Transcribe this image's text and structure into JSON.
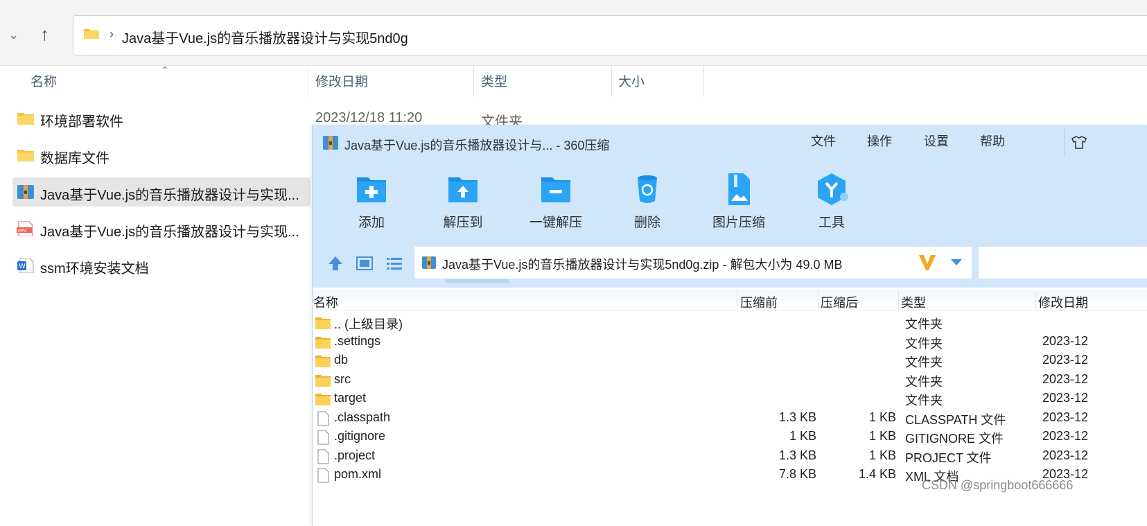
{
  "explorer": {
    "address_path": "Java基于Vue.js的音乐播放器设计与实现5nd0g",
    "columns": {
      "name": "名称",
      "modified": "修改日期",
      "type": "类型",
      "size": "大小"
    },
    "rows": [
      {
        "name": "环境部署软件",
        "date": "2023/12/18 11:20",
        "type": "文件夹",
        "icon": "folder-icon"
      },
      {
        "name": "数据库文件",
        "icon": "folder-icon"
      },
      {
        "name": "Java基于Vue.js的音乐播放器设计与实现...",
        "icon": "zip-archive-icon",
        "selected": true
      },
      {
        "name": "Java基于Vue.js的音乐播放器设计与实现...",
        "icon": "mp4-file-icon"
      },
      {
        "name": "ssm环境安装文档",
        "icon": "word-doc-icon"
      }
    ]
  },
  "zip_app": {
    "title": "Java基于Vue.js的音乐播放器设计与... - 360压缩",
    "menu": [
      "文件",
      "操作",
      "设置",
      "帮助"
    ],
    "toolbar": [
      {
        "label": "添加",
        "icon": "add-icon"
      },
      {
        "label": "解压到",
        "icon": "extract-to-icon"
      },
      {
        "label": "一键解压",
        "icon": "one-click-extract-icon"
      },
      {
        "label": "删除",
        "icon": "delete-icon"
      },
      {
        "label": "图片压缩",
        "icon": "image-compress-icon"
      },
      {
        "label": "工具",
        "icon": "tools-icon"
      }
    ],
    "path": "Java基于Vue.js的音乐播放器设计与实现5nd0g.zip - 解包大小为 49.0 MB",
    "columns": {
      "name": "名称",
      "before": "压缩前",
      "after": "压缩后",
      "type": "类型",
      "modified": "修改日期"
    },
    "files": [
      {
        "name": ".. (上级目录)",
        "before": "",
        "after": "",
        "type": "文件夹",
        "date": "",
        "icon": "folder-icon"
      },
      {
        "name": ".settings",
        "before": "",
        "after": "",
        "type": "文件夹",
        "date": "2023-12",
        "icon": "folder-icon"
      },
      {
        "name": "db",
        "before": "",
        "after": "",
        "type": "文件夹",
        "date": "2023-12",
        "icon": "folder-icon"
      },
      {
        "name": "src",
        "before": "",
        "after": "",
        "type": "文件夹",
        "date": "2023-12",
        "icon": "folder-icon"
      },
      {
        "name": "target",
        "before": "",
        "after": "",
        "type": "文件夹",
        "date": "2023-12",
        "icon": "folder-icon"
      },
      {
        "name": ".classpath",
        "before": "1.3 KB",
        "after": "1 KB",
        "type": "CLASSPATH 文件",
        "date": "2023-12",
        "icon": "file-icon"
      },
      {
        "name": ".gitignore",
        "before": "1 KB",
        "after": "1 KB",
        "type": "GITIGNORE 文件",
        "date": "2023-12",
        "icon": "file-icon"
      },
      {
        "name": ".project",
        "before": "1.3 KB",
        "after": "1 KB",
        "type": "PROJECT 文件",
        "date": "2023-12",
        "icon": "file-icon"
      },
      {
        "name": "pom.xml",
        "before": "7.8 KB",
        "after": "1.4 KB",
        "type": "XML 文档",
        "date": "2023-12",
        "icon": "file-icon"
      }
    ]
  },
  "watermark": "CSDN @springboot666666"
}
